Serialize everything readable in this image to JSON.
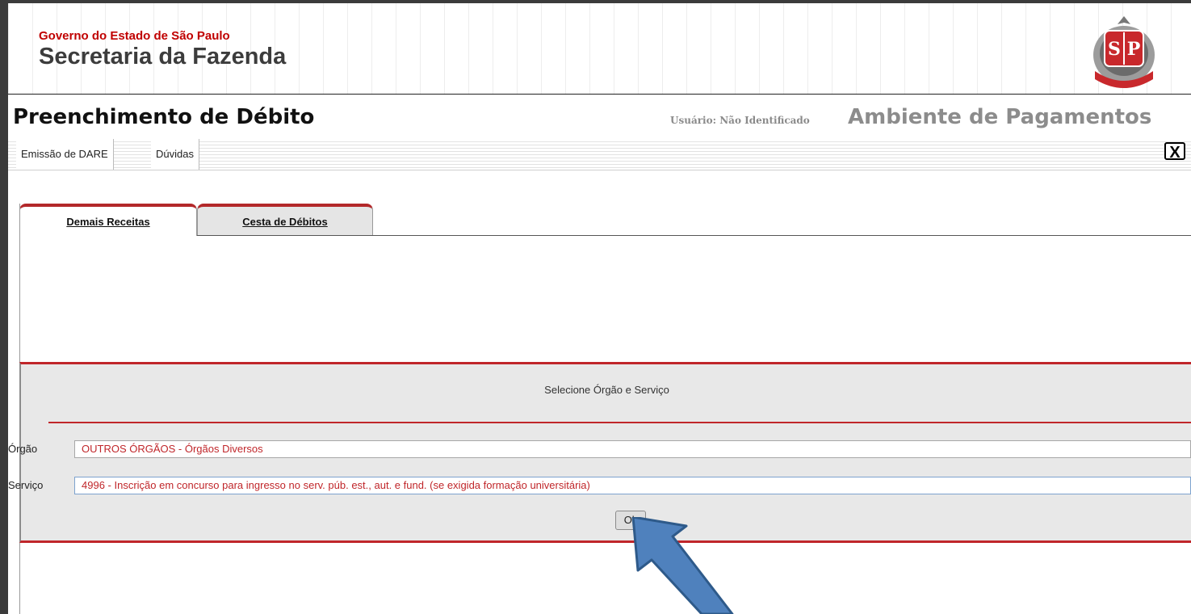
{
  "header": {
    "government": "Governo do Estado de São Paulo",
    "secretariat": "Secretaria da Fazenda",
    "emblem_text": "SP"
  },
  "title_bar": {
    "page_title": "Preenchimento de Débito",
    "user_status": "Usuário: Não Identificado",
    "environment": "Ambiente de Pagamentos"
  },
  "menu": {
    "items": [
      {
        "label": "Emissão de DARE"
      },
      {
        "label": "Dúvidas"
      }
    ],
    "close_label": "X"
  },
  "tabs": [
    {
      "label": "Demais Receitas",
      "active": true
    },
    {
      "label": "Cesta de Débitos",
      "active": false
    }
  ],
  "form": {
    "title": "Selecione Órgão e Serviço",
    "orgao_label": "Órgão",
    "orgao_value": "OUTROS ÓRGÃOS - Órgãos Diversos",
    "servico_label": "Serviço",
    "servico_value": "4996 - Inscrição em concurso para ingresso no serv. púb. est., aut. e fund. (se exigida formação universitária)",
    "ok_label": "Ok"
  },
  "colors": {
    "accent_red": "#c0262a",
    "panel_bg": "#e8e8e8",
    "arrow_blue": "#4f81bd"
  }
}
